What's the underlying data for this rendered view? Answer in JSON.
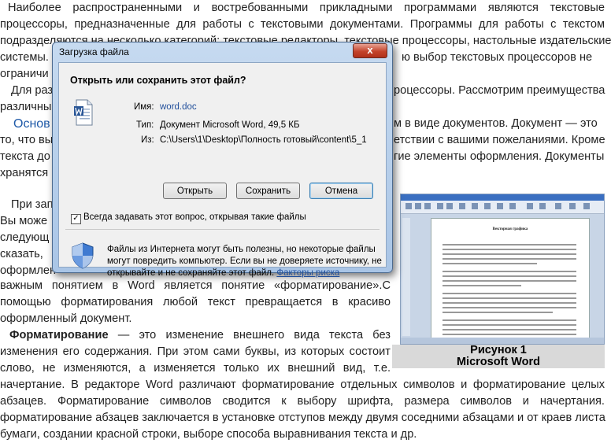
{
  "document": {
    "lines": [
      "Наиболее распространенными и востребованными прикладными программами являются текстовые",
      "процессоры, предназначенные для работы с текстовыми документами. Программы для работы с текстом",
      "подразделяются на несколько категорий: текстовые редакторы, текстовые процессоры, настольные издательские",
      "системы.",
      "ограничи",
      "Для раз",
      "различны",
      "то, что вы",
      "текста до",
      "хранятся"
    ],
    "line3_tail": "ю выбор текстовых процессоров не",
    "line5_tail": "роцессоры. Рассмотрим преимущества",
    "line6_tail": "",
    "blue_word": "Основ",
    "line7_tail": "м в виде документов. Документ — это",
    "line8_tail": "етствии с вашими пожеланиями. Кроме",
    "line9_tail": "гие элементы оформления. Документы",
    "lower_left": [
      "При зап",
      "Вы може",
      "следующ",
      "сказать,",
      "оформлен"
    ],
    "para_a": "важным понятием в Word является понятие «форматирование».С",
    "para_b": "помощью форматирования любой текст превращается в красиво",
    "para_c": "оформленный документ.",
    "fmt_term": "Форматирование",
    "fmt_rest": " — это изменение внешнего вида текста без",
    "line_d": "изменения его содержания. При этом сами буквы, из которых состоит",
    "line_e": "слово, не изменяются, а изменяется только их внешний   вид, т.е.",
    "line_f": "начертание. В редакторе Word различают форматирование отдельных символов и форматирование целых",
    "line_g": "абзацев. Форматирование символов сводится к выбору шрифта, размера символов и начертания.",
    "line_h": "форматирование абзацев заключается в установке отступов между  двумя соседними абзацами и от краев листа",
    "line_i": "бумаги, создании красной   строки, выборе способа выравнивания текста и др."
  },
  "figure": {
    "caption_line1": "Рисунок 1",
    "caption_line2": "Microsoft Word",
    "page_title": "Векторная графика"
  },
  "dialog": {
    "title": "Загрузка файла",
    "close_label": "x",
    "heading": "Открыть или сохранить этот файл?",
    "name_label": "Имя:",
    "name_value": "word.doc",
    "type_label": "Тип:",
    "type_value": "Документ Microsoft Word, 49,5 КБ",
    "from_label": "Из:",
    "from_value": "C:\\Users\\1\\Desktop\\Полность готовый\\content\\5_1",
    "open_button": "Открыть",
    "save_button": "Сохранить",
    "cancel_button": "Отмена",
    "always_ask_checked": true,
    "always_ask_label": "Всегда задавать этот вопрос, открывая такие файлы",
    "warning_line1": "Файлы из Интернета могут быть полезны, но некоторые файлы",
    "warning_line2": "могут повредить компьютер. Если вы не доверяете источнику, не",
    "warning_line3": "открывайте и не сохраняйте этот файл.",
    "risk_link": "Факторы риска"
  },
  "icons": {
    "file": "word-document-icon",
    "shield": "security-shield-icon",
    "close": "close-icon"
  },
  "colors": {
    "close_button": "#c4432b",
    "link": "#1f4d9a",
    "dialog_frame": "#a9c5e6"
  }
}
